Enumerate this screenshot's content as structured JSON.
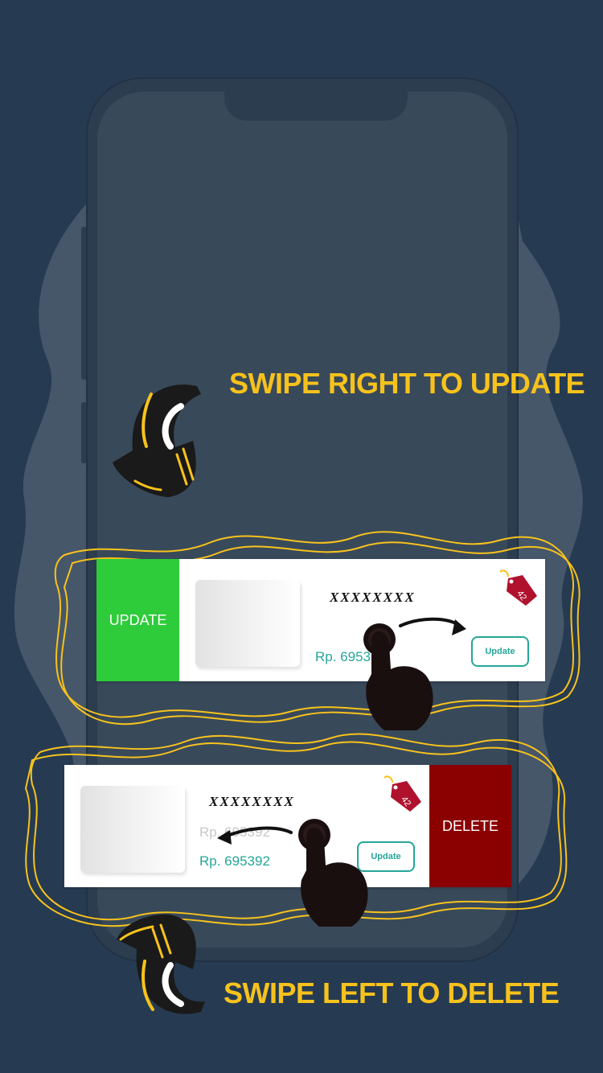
{
  "headlines": {
    "update": "SWIPE RIGHT TO UPDATE",
    "delete": "SWIPE LEFT TO DELETE"
  },
  "cards": {
    "update_card": {
      "action_label": "UPDATE",
      "title": "XXXXXXXX",
      "price": "Rp. 695392",
      "button_label": "Update",
      "tag_text": "42"
    },
    "delete_card": {
      "action_label": "DELETE",
      "title": "XXXXXXXX",
      "price": "Rp. 695392",
      "price_ghost": "Rp. 695392",
      "button_label": "Update",
      "tag_text": "42"
    }
  },
  "colors": {
    "background": "#263b52",
    "accent_yellow": "#f7c21c",
    "update_green": "#2ecc3a",
    "delete_red": "#8b0000",
    "teal": "#26a69a"
  }
}
